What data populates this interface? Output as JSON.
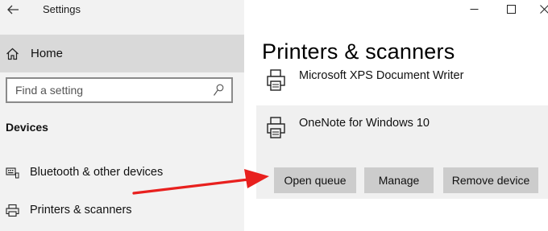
{
  "window": {
    "app_title": "Settings"
  },
  "sidebar": {
    "home_label": "Home",
    "search_placeholder": "Find a setting",
    "section_heading": "Devices",
    "items": [
      {
        "label": "Bluetooth & other devices",
        "icon": "bluetooth-keyboard-icon"
      },
      {
        "label": "Printers & scanners",
        "icon": "printer-icon"
      }
    ]
  },
  "main": {
    "title": "Printers & scanners",
    "devices": [
      {
        "name": "Microsoft XPS Document Writer",
        "icon": "printer-icon"
      },
      {
        "name": "OneNote for Windows 10",
        "icon": "printer-icon",
        "selected": true
      }
    ],
    "actions": {
      "open_queue": "Open queue",
      "manage": "Manage",
      "remove_device": "Remove device"
    }
  },
  "annotation": {
    "arrow_color": "#e8201e"
  },
  "colors": {
    "sidebar_bg": "#f2f2f2",
    "home_selected_bg": "#d9d9d9",
    "button_bg": "#cccccc",
    "selected_row_bg": "#f0f0f0"
  }
}
